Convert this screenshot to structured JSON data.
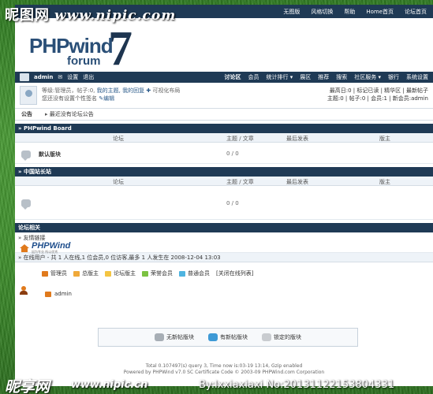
{
  "watermark": {
    "top_cn": "昵图网",
    "top_url": "www.nipic.com",
    "bottom_cn": "昵享网",
    "bottom_url": "www.nipic.cn",
    "bottom_by": "By:lxxiaxiaxi No:20131122153804331"
  },
  "topbar": {
    "items": [
      "无图版",
      "风格切换",
      "帮助",
      "Home首页",
      "论坛首页"
    ]
  },
  "logo": {
    "text": "PHPwind",
    "sub": "forum",
    "num": "7"
  },
  "navbar": {
    "username": "admin",
    "links": [
      "设置",
      "退出"
    ],
    "menu": [
      "讨论区",
      "会员",
      "统计排行 ▾",
      "展区",
      "推荐",
      "搜索",
      "社区服务 ▾",
      "银行",
      "系统设置"
    ]
  },
  "userinfo": {
    "line1_prefix": "等级:管理员，帖子:0,",
    "line1_links": "我的主题, 我的回复",
    "line1_suffix": "可视化布局",
    "line2": "您还没有设置个性签名",
    "line2_edit": "✎编辑",
    "right1": "最高日:0 | 标记已读 | 精华区 | 最新帖子",
    "right2": "主题:0 | 帖子:0 | 会员:1 | 新会员:admin"
  },
  "notice": {
    "label": "公告",
    "text": "最近没有论坛公告"
  },
  "sections": [
    {
      "title": "» PHPwind Board",
      "headers": {
        "forum": "论坛",
        "topic": "主题 / 文章",
        "last": "最后发表",
        "mod": "版主"
      },
      "rows": [
        {
          "name": "默认版块",
          "count": "0 / 0"
        }
      ]
    },
    {
      "title": "» 中国站长站",
      "headers": {
        "forum": "论坛",
        "topic": "主题 / 文章",
        "last": "最后发表",
        "mod": "版主"
      },
      "rows": [
        {
          "name": "",
          "count": "0 / 0"
        }
      ]
    }
  ],
  "related": {
    "title": "论坛相关",
    "links_label": "» 友情链接",
    "brand": "PHPWind",
    "brand_sub": "因为专业 所以优秀",
    "online_head": "» 在线用户 - 共 1 人在线,1 位会员,0 位访客,最多 1 人发生在 2008-12-04 13:03",
    "legend": [
      {
        "label": "管理员",
        "color": "#e07a1c"
      },
      {
        "label": "总版主",
        "color": "#f0a93a"
      },
      {
        "label": "论坛版主",
        "color": "#f4c542"
      },
      {
        "label": "荣誉会员",
        "color": "#7cc242"
      },
      {
        "label": "普通会员",
        "color": "#4fb4e0"
      }
    ],
    "legend_close": "[关闭在线列表]",
    "online_user": "admin"
  },
  "footer_legend": [
    "无新帖版块",
    "有新帖版块",
    "锁定的版块"
  ],
  "footer": {
    "line1": "Total 0.107497(s) query 3, Time now is:03-19 13:14, Gzip enabled",
    "line2": "Powered by PHPWind v7.0 SC Certificate Code © 2003-09 PHPWind.com Corporation"
  }
}
